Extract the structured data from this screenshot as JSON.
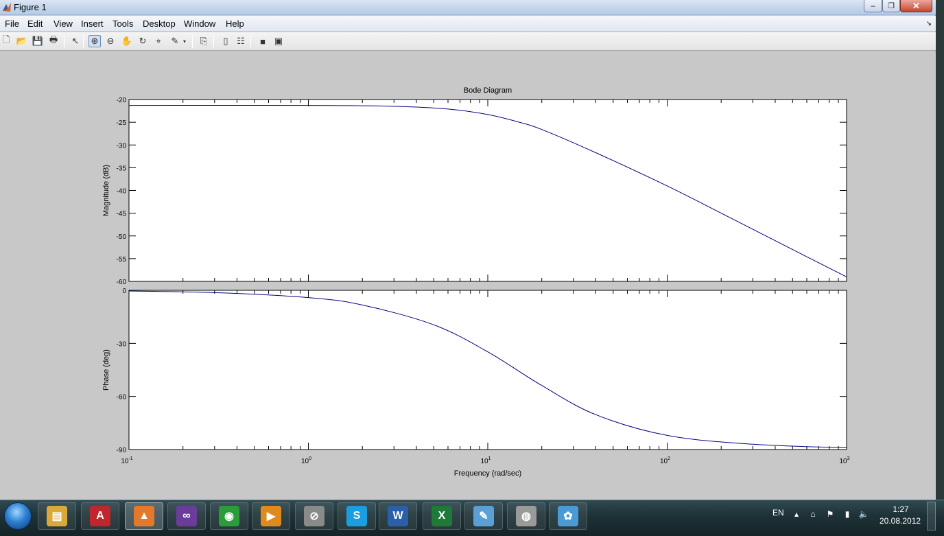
{
  "window": {
    "title": "Figure 1",
    "controls": {
      "minimize": "‒",
      "maximize": "❐",
      "close": "✕"
    }
  },
  "menubar": {
    "items": [
      "File",
      "Edit",
      "View",
      "Insert",
      "Tools",
      "Desktop",
      "Window",
      "Help"
    ],
    "overflow_glyph": "↘"
  },
  "toolbar": {
    "buttons": [
      {
        "name": "new-figure-icon",
        "glyph": "🗋"
      },
      {
        "name": "open-file-icon",
        "glyph": "📂"
      },
      {
        "name": "save-icon",
        "glyph": "💾"
      },
      {
        "name": "print-icon",
        "glyph": "🖶"
      },
      {
        "name": "edit-plot-icon",
        "glyph": "↖"
      },
      {
        "name": "zoom-in-icon",
        "glyph": "⊕",
        "active": true
      },
      {
        "name": "zoom-out-icon",
        "glyph": "⊖"
      },
      {
        "name": "pan-icon",
        "glyph": "✋"
      },
      {
        "name": "rotate-3d-icon",
        "glyph": "↻"
      },
      {
        "name": "data-cursor-icon",
        "glyph": "⌖"
      },
      {
        "name": "brush-icon",
        "glyph": "✎"
      },
      {
        "name": "link-plot-icon",
        "glyph": "⎘"
      },
      {
        "name": "insert-colorbar-icon",
        "glyph": "▯"
      },
      {
        "name": "insert-legend-icon",
        "glyph": "☷"
      },
      {
        "name": "hide-plot-tools-icon",
        "glyph": "■"
      },
      {
        "name": "show-plot-tools-icon",
        "glyph": "▣"
      }
    ]
  },
  "chart_data": {
    "type": "line",
    "title": "Bode Diagram",
    "xlabel": "Frequency  (rad/sec)",
    "x_scale": "log",
    "xlim": [
      0.1,
      1000
    ],
    "x_ticks": [
      {
        "base": "10",
        "exp": "-1"
      },
      {
        "base": "10",
        "exp": "0"
      },
      {
        "base": "10",
        "exp": "1"
      },
      {
        "base": "10",
        "exp": "2"
      },
      {
        "base": "10",
        "exp": "3"
      }
    ],
    "line_color": "#00007f",
    "panels": [
      {
        "ylabel": "Magnitude (dB)",
        "ylim": [
          -60,
          -20
        ],
        "y_ticks": [
          "-20",
          "-25",
          "-30",
          "-35",
          "-40",
          "-45",
          "-50",
          "-55",
          "-60"
        ],
        "series": [
          {
            "x": [
              0.1,
              1,
              3,
              6,
              10,
              15,
              20,
              40,
              100,
              200,
              500,
              1000
            ],
            "y": [
              -21.3,
              -21.3,
              -21.5,
              -22.1,
              -23.3,
              -25.0,
              -26.6,
              -31.7,
              -39.0,
              -45.0,
              -53.0,
              -59.0
            ]
          }
        ]
      },
      {
        "ylabel": "Phase (deg)",
        "ylim": [
          -90,
          0
        ],
        "y_ticks": [
          "0",
          "-30",
          "-60",
          "-90"
        ],
        "series": [
          {
            "x": [
              0.1,
              0.3,
              1,
              2,
              5,
              10,
              20,
              40,
              100,
              300,
              1000
            ],
            "y": [
              -0.4,
              -1.3,
              -4.1,
              -8.3,
              -19.5,
              -34.8,
              -53.8,
              -70.3,
              -82.0,
              -87.0,
              -89.0
            ]
          }
        ]
      }
    ]
  },
  "taskbar": {
    "apps": [
      {
        "name": "taskbar-explorer",
        "label": "▤",
        "color": "#d9a93a",
        "state": "pinned"
      },
      {
        "name": "taskbar-acrobat",
        "label": "A",
        "color": "#c0262d",
        "state": "pinned"
      },
      {
        "name": "taskbar-matlab",
        "label": "▲",
        "color": "#e5792a",
        "state": "open"
      },
      {
        "name": "taskbar-visual-studio",
        "label": "∞",
        "color": "#6a3d9a",
        "state": "pinned"
      },
      {
        "name": "taskbar-chrome",
        "label": "◉",
        "color": "#2a9d3a",
        "state": "pinned"
      },
      {
        "name": "taskbar-media-player",
        "label": "▶",
        "color": "#e08a1e",
        "state": "pinned"
      },
      {
        "name": "taskbar-tool",
        "label": "⊘",
        "color": "#8a8a8a",
        "state": "pinned"
      },
      {
        "name": "taskbar-skype",
        "label": "S",
        "color": "#1a9ee0",
        "state": "pinned"
      },
      {
        "name": "taskbar-word",
        "label": "W",
        "color": "#2b5faa",
        "state": "pinned"
      },
      {
        "name": "taskbar-excel",
        "label": "X",
        "color": "#1f7a3a",
        "state": "pinned"
      },
      {
        "name": "taskbar-notes",
        "label": "✎",
        "color": "#5a9fd6",
        "state": "pinned"
      },
      {
        "name": "taskbar-audio",
        "label": "◍",
        "color": "#9a9a9a",
        "state": "pinned"
      },
      {
        "name": "taskbar-paint",
        "label": "✿",
        "color": "#4a9ad6",
        "state": "pinned"
      }
    ],
    "tray": {
      "language": "EN",
      "icons": [
        {
          "name": "tray-overflow-icon",
          "glyph": "▴"
        },
        {
          "name": "tray-usb-icon",
          "glyph": "⌂"
        },
        {
          "name": "tray-flag-icon",
          "glyph": "⚑"
        },
        {
          "name": "tray-network-icon",
          "glyph": "▮"
        },
        {
          "name": "tray-volume-icon",
          "glyph": "🔈"
        }
      ],
      "time": "1:27",
      "date": "20.08.2012"
    }
  }
}
